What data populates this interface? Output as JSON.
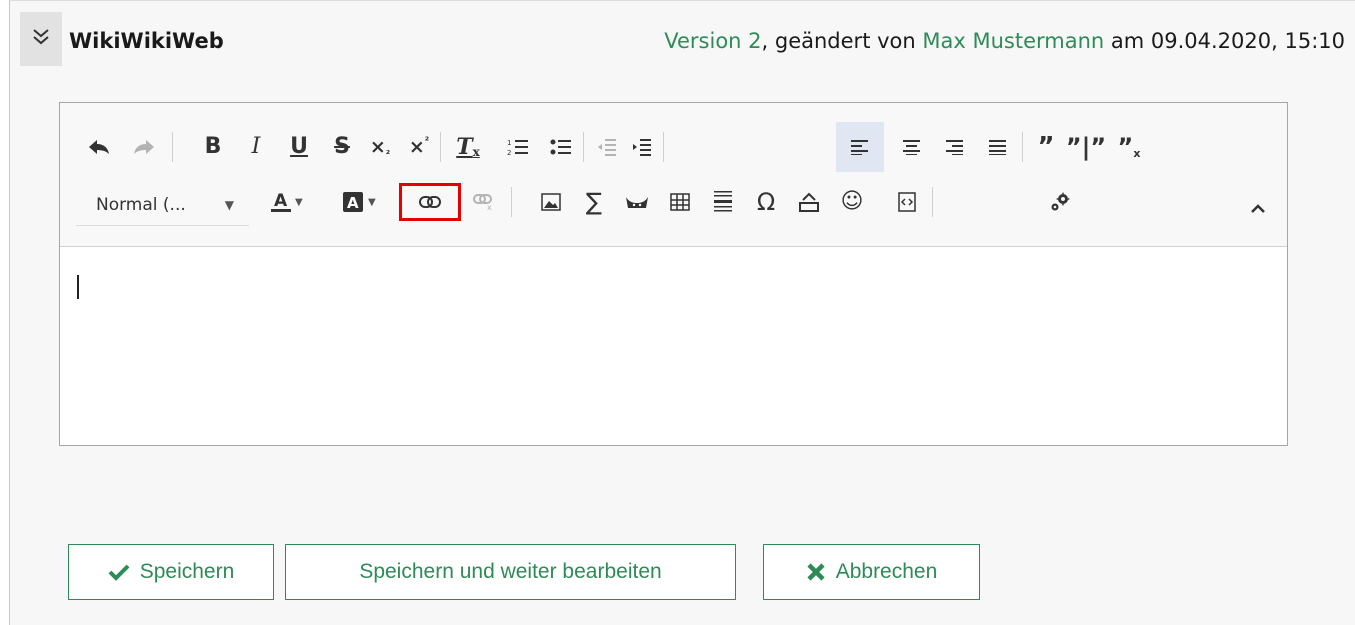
{
  "header": {
    "title": "WikiWikiWeb",
    "version_link": "Version 2",
    "changed_by_text": ", geändert von ",
    "author_link": "Max Mustermann",
    "date_text": " am 09.04.2020, 15:10"
  },
  "toolbar": {
    "format_select": "Normal (...",
    "icons": [
      "undo-icon",
      "redo-icon",
      "bold-icon",
      "italic-icon",
      "underline-icon",
      "strikethrough-icon",
      "subscript-icon",
      "superscript-icon",
      "remove-format-icon",
      "numbered-list-icon",
      "bulleted-list-icon",
      "decrease-indent-icon",
      "increase-indent-icon",
      "align-left-icon",
      "align-center-icon",
      "align-right-icon",
      "justify-icon",
      "blockquote-icon",
      "split-quote-icon",
      "remove-quote-icon",
      "text-color-icon",
      "background-color-icon",
      "link-icon",
      "unlink-icon",
      "image-icon",
      "math-icon",
      "mascot-icon",
      "table-icon",
      "horizontal-rule-icon",
      "special-char-icon",
      "page-break-icon",
      "smiley-icon",
      "source-icon",
      "settings-icon",
      "collapse-toolbar-icon"
    ],
    "highlighted_button": "link-icon",
    "active_button": "align-left-icon"
  },
  "editor": {
    "content": ""
  },
  "buttons": {
    "save": "Speichern",
    "save_continue": "Speichern und weiter bearbeiten",
    "cancel": "Abbrechen"
  },
  "colors": {
    "accent": "#2e8b57",
    "highlight": "#e50000",
    "active_bg": "#e1e7f2"
  }
}
